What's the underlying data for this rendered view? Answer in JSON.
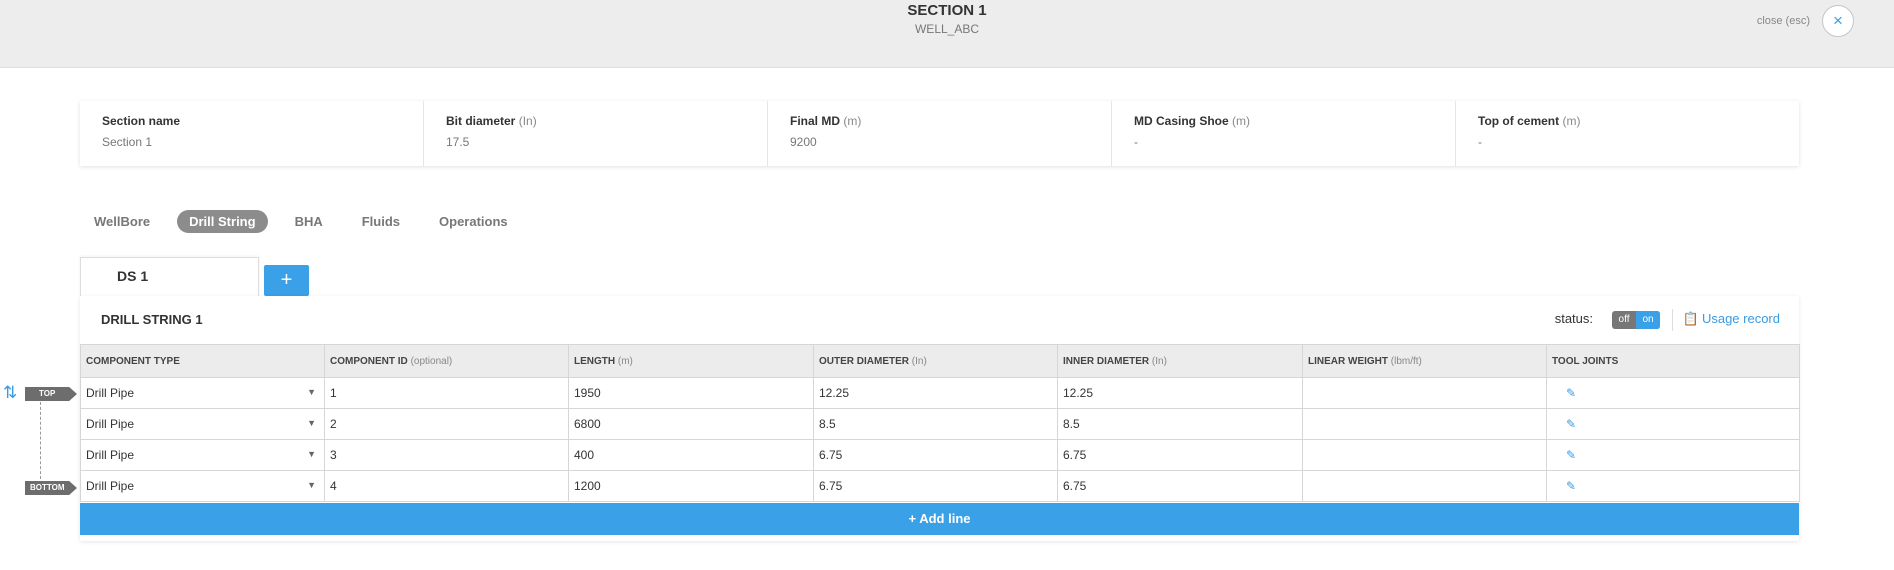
{
  "header": {
    "title": "SECTION 1",
    "subtitle": "WELL_ABC",
    "close_label": "close (esc)",
    "close_icon": "×"
  },
  "summary": [
    {
      "label": "Section name",
      "unit": "",
      "value": "Section 1"
    },
    {
      "label": "Bit diameter",
      "unit": "(In)",
      "value": "17.5"
    },
    {
      "label": "Final MD",
      "unit": "(m)",
      "value": "9200"
    },
    {
      "label": "MD Casing Shoe",
      "unit": "(m)",
      "value": "-"
    },
    {
      "label": "Top of cement",
      "unit": "(m)",
      "value": "-"
    }
  ],
  "tabs": [
    "WellBore",
    "Drill String",
    "BHA",
    "Fluids",
    "Operations"
  ],
  "active_tab": "Drill String",
  "drill_string_tabs": [
    "DS 1"
  ],
  "add_ds_label": "+",
  "panel": {
    "title": "DRILL STRING 1",
    "status_label": "status:",
    "toggle_off": "off",
    "toggle_on": "on",
    "usage_record": "Usage record"
  },
  "table": {
    "columns": [
      {
        "label": "COMPONENT TYPE",
        "unit": ""
      },
      {
        "label": "COMPONENT ID",
        "unit": "(optional)"
      },
      {
        "label": "LENGTH",
        "unit": "(m)"
      },
      {
        "label": "OUTER DIAMETER",
        "unit": "(In)"
      },
      {
        "label": "INNER DIAMETER",
        "unit": "(In)"
      },
      {
        "label": "LINEAR WEIGHT",
        "unit": "(lbm/ft)"
      },
      {
        "label": "TOOL JOINTS",
        "unit": ""
      }
    ],
    "rows": [
      {
        "type": "Drill Pipe",
        "id": "1",
        "length": "1950",
        "od": "12.25",
        "id_in": "12.25",
        "weight": ""
      },
      {
        "type": "Drill Pipe",
        "id": "2",
        "length": "6800",
        "od": "8.5",
        "id_in": "8.5",
        "weight": ""
      },
      {
        "type": "Drill Pipe",
        "id": "3",
        "length": "400",
        "od": "6.75",
        "id_in": "6.75",
        "weight": ""
      },
      {
        "type": "Drill Pipe",
        "id": "4",
        "length": "1200",
        "od": "6.75",
        "id_in": "6.75",
        "weight": ""
      }
    ]
  },
  "add_line_label": "+ Add line",
  "markers": {
    "top": "TOP",
    "bottom": "BOTTOM"
  },
  "colors": {
    "accent": "#3aa0e8",
    "tab_active": "#8c8c8c"
  }
}
